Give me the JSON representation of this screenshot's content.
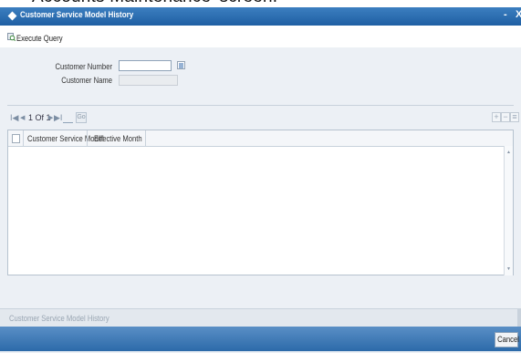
{
  "overlay_text": "Accounts Maintenance' screen.",
  "window": {
    "title": "Customer Service Model History",
    "minimize_glyph": "-",
    "close_glyph": "X"
  },
  "toolbar": {
    "execute_query_label": "Execute Query",
    "execute_query_icon": "execute-query-icon"
  },
  "form": {
    "customer_number_label": "Customer Number",
    "customer_number_value": "",
    "customer_name_label": "Customer Name",
    "customer_name_value": ""
  },
  "pagination": {
    "first_glyph": "I◀",
    "prev_glyph": "◀",
    "page_text": "1 Of 1",
    "next_glyph": "▶",
    "last_glyph": "▶I",
    "go_label": "Go"
  },
  "grid_actions": {
    "add": "+",
    "delete": "−",
    "view": "≡"
  },
  "grid": {
    "columns": [
      "Customer Service Model",
      "Effective Month"
    ],
    "rows": []
  },
  "footer": {
    "tab_label": "Customer Service Model History"
  },
  "actions": {
    "cancel_label": "Cancel"
  },
  "colors": {
    "title_bar": "#2a6cb0",
    "panel_background": "#ecf0f5",
    "bottom_bar": "#3a78b6"
  }
}
